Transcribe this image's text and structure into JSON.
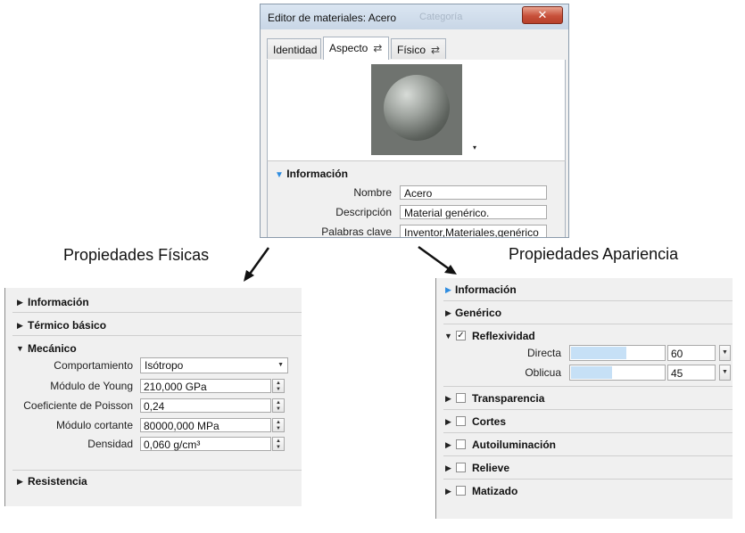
{
  "dialog": {
    "title": "Editor de materiales: Acero",
    "ghost_title": "Categoría",
    "close_glyph": "✕",
    "tabs": [
      {
        "label": "Identidad",
        "has_swap": false
      },
      {
        "label": "Aspecto",
        "has_swap": true,
        "active": true
      },
      {
        "label": "Físico",
        "has_swap": true
      }
    ],
    "swap_glyph": "⇄",
    "dropdown_glyph": "▾",
    "info": {
      "header": "Información",
      "fields": [
        {
          "label": "Nombre",
          "value": "Acero"
        },
        {
          "label": "Descripción",
          "value": "Material genérico."
        },
        {
          "label": "Palabras clave",
          "value": "Inventor,Materiales,genérico"
        }
      ]
    }
  },
  "captions": {
    "physical": "Propiedades Físicas",
    "appearance": "Propiedades Apariencia"
  },
  "physical_panel": {
    "sections": {
      "informacion": "Información",
      "termico": "Térmico básico",
      "mecanico": "Mecánico",
      "resistencia": "Resistencia"
    },
    "mechanical": {
      "behavior": {
        "label": "Comportamiento",
        "value": "Isótropo"
      },
      "properties": [
        {
          "label": "Módulo de Young",
          "value": "210,000 GPa"
        },
        {
          "label": "Coeficiente de Poisson",
          "value": "0,24"
        },
        {
          "label": "Módulo cortante",
          "value": "80000,000 MPa"
        },
        {
          "label": "Densidad",
          "value": "0,060 g/cm³"
        }
      ]
    }
  },
  "appearance_panel": {
    "sections": {
      "informacion": "Información",
      "generico": "Genérico",
      "reflexividad": "Reflexividad",
      "transparencia": "Transparencia",
      "cortes": "Cortes",
      "autoiluminacion": "Autoiluminación",
      "relieve": "Relieve",
      "matizado": "Matizado"
    },
    "check_glyph": "✓",
    "reflectivity": {
      "checked": true,
      "rows": [
        {
          "label": "Directa",
          "value": "60",
          "level_percent": 60
        },
        {
          "label": "Oblicua",
          "value": "45",
          "level_percent": 45
        }
      ]
    }
  },
  "colors": {
    "accent_triangle": "#2e8ce0",
    "slider_fill": "#c6e0f6"
  }
}
